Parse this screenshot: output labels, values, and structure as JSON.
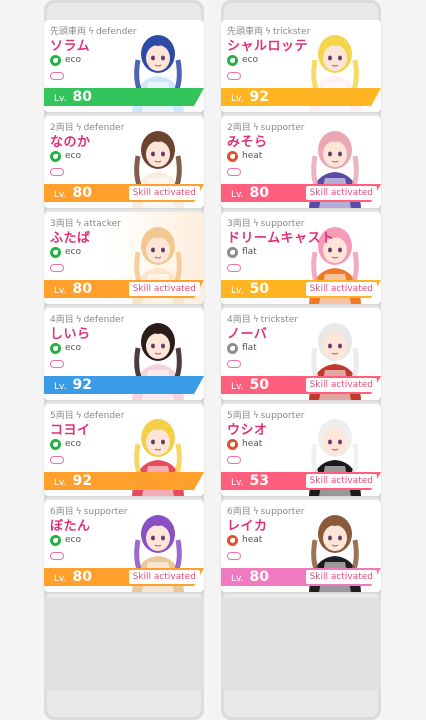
{
  "left": [
    {
      "position": "先頭車両",
      "role": "defender",
      "name": "ソラム",
      "attribute": "eco",
      "level": "80",
      "level_label": "Lv.",
      "skill": "",
      "bar_color": "#33c45b",
      "attr_color": "#25b045",
      "hair": "#2c4aa6",
      "accent": "#cfe6ff"
    },
    {
      "position": "2両目",
      "role": "defender",
      "name": "なのか",
      "attribute": "eco",
      "level": "80",
      "level_label": "Lv.",
      "skill": "Skill activated",
      "bar_color": "#ff9f2c",
      "attr_color": "#25b045",
      "hair": "#6b4330",
      "accent": "#f7eee0"
    },
    {
      "position": "3両目",
      "role": "attacker",
      "name": "ふたば",
      "attribute": "eco",
      "level": "80",
      "level_label": "Lv.",
      "skill": "Skill activated",
      "bar_color": "#ff9f2c",
      "attr_color": "#25b045",
      "hair": "#f0c890",
      "accent": "#fde6c8"
    },
    {
      "position": "4両目",
      "role": "defender",
      "name": "しいら",
      "attribute": "eco",
      "level": "92",
      "level_label": "Lv.",
      "skill": "",
      "bar_color": "#3a9be6",
      "attr_color": "#25b045",
      "hair": "#2b1b1b",
      "accent": "#f6d3dc"
    },
    {
      "position": "5両目",
      "role": "defender",
      "name": "コヨイ",
      "attribute": "eco",
      "level": "92",
      "level_label": "Lv.",
      "skill": "",
      "bar_color": "#ff9f2c",
      "attr_color": "#25b045",
      "hair": "#f4d04a",
      "accent": "#e84b5b"
    },
    {
      "position": "6両目",
      "role": "supporter",
      "name": "ぼたん",
      "attribute": "eco",
      "level": "80",
      "level_label": "Lv.",
      "skill": "Skill activated",
      "bar_color": "#ff9f2c",
      "attr_color": "#25b045",
      "hair": "#8a4fc4",
      "accent": "#e9c99a"
    }
  ],
  "right": [
    {
      "position": "先頭車両",
      "role": "trickster",
      "name": "シャルロッテ",
      "attribute": "eco",
      "level": "92",
      "level_label": "Lv.",
      "skill": "",
      "bar_color": "#ffb422",
      "attr_color": "#25b045",
      "hair": "#f4d64a",
      "accent": "#fff0f3"
    },
    {
      "position": "2両目",
      "role": "supporter",
      "name": "みそら",
      "attribute": "heat",
      "level": "80",
      "level_label": "Lv.",
      "skill": "Skill activated",
      "bar_color": "#ff5f7d",
      "attr_color": "#e4502a",
      "hair": "#e9a8b4",
      "accent": "#5b4aa8"
    },
    {
      "position": "3両目",
      "role": "supporter",
      "name": "ドリームキャスト",
      "attribute": "flat",
      "level": "50",
      "level_label": "Lv.",
      "skill": "Skill activated",
      "bar_color": "#ffb422",
      "attr_color": "#8c8c8c",
      "hair": "#f59ab8",
      "accent": "#f07a2a"
    },
    {
      "position": "4両目",
      "role": "trickster",
      "name": "ノーバ",
      "attribute": "flat",
      "level": "50",
      "level_label": "Lv.",
      "skill": "Skill activated",
      "bar_color": "#ff5f7d",
      "attr_color": "#8c8c8c",
      "hair": "#e8e8e8",
      "accent": "#c0392b"
    },
    {
      "position": "5両目",
      "role": "supporter",
      "name": "ウシオ",
      "attribute": "heat",
      "level": "53",
      "level_label": "Lv.",
      "skill": "Skill activated",
      "bar_color": "#ff5f7d",
      "attr_color": "#e4502a",
      "hair": "#eeeeee",
      "accent": "#1b1b1b"
    },
    {
      "position": "6両目",
      "role": "supporter",
      "name": "レイカ",
      "attribute": "heat",
      "level": "80",
      "level_label": "Lv.",
      "skill": "Skill activated",
      "bar_color": "#f07ac2",
      "attr_color": "#e4502a",
      "hair": "#8a5a3a",
      "accent": "#1f1f1f"
    }
  ],
  "icons": {
    "role": "lightning-bolt-icon",
    "attribute": "leaf-icon",
    "link": "pink-pill-icon"
  }
}
